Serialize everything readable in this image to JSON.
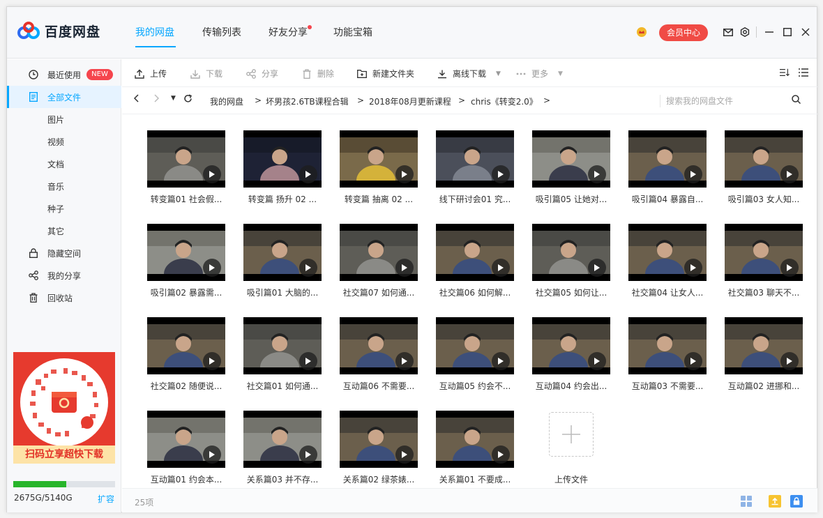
{
  "app": {
    "name": "百度网盘"
  },
  "nav": {
    "tabs": [
      "我的网盘",
      "传输列表",
      "好友分享",
      "功能宝箱"
    ],
    "active_index": 0
  },
  "header": {
    "vip_label": "会员中心"
  },
  "sidebar": {
    "items": [
      {
        "label": "最近使用",
        "badge": "NEW",
        "icon": "clock-icon"
      },
      {
        "label": "全部文件",
        "icon": "file-icon",
        "active": true
      },
      {
        "label": "图片"
      },
      {
        "label": "视频"
      },
      {
        "label": "文档"
      },
      {
        "label": "音乐"
      },
      {
        "label": "种子"
      },
      {
        "label": "其它"
      },
      {
        "label": "隐藏空间",
        "icon": "lock-icon"
      },
      {
        "label": "我的分享",
        "icon": "share-icon"
      },
      {
        "label": "回收站",
        "icon": "trash-icon"
      }
    ],
    "promo_text": "扫码立享超快下载",
    "storage": {
      "text": "2675G/5140G",
      "used_fraction": 0.52,
      "expand_label": "扩容"
    }
  },
  "toolbar": {
    "upload": "上传",
    "download": "下载",
    "share": "分享",
    "delete": "删除",
    "new_folder": "新建文件夹",
    "offline_download": "离线下载",
    "more": "更多"
  },
  "breadcrumb": {
    "items": [
      "我的网盘",
      "坏男孩2.6TB课程合辑",
      "2018年08月更新课程",
      "chris《转变2.0》"
    ],
    "separator": ">"
  },
  "search": {
    "placeholder": "搜索我的网盘文件"
  },
  "files": [
    {
      "name": "转变篇01 社会假...",
      "scene": "a"
    },
    {
      "name": "转变篇 扬升 02 ...",
      "scene": "f"
    },
    {
      "name": "转变篇 抽离 02 ...",
      "scene": "y"
    },
    {
      "name": "线下研讨会01 究...",
      "scene": "c"
    },
    {
      "name": "吸引篇05 让她对...",
      "scene": "o"
    },
    {
      "name": "吸引篇04 暴露自...",
      "scene": "b"
    },
    {
      "name": "吸引篇03 女人知...",
      "scene": "b"
    },
    {
      "name": "吸引篇02 暴露需...",
      "scene": "o"
    },
    {
      "name": "吸引篇01 大脑的...",
      "scene": "b"
    },
    {
      "name": "社交篇07 如何通...",
      "scene": "a"
    },
    {
      "name": "社交篇06 如何解...",
      "scene": "b"
    },
    {
      "name": "社交篇05 如何让...",
      "scene": "a"
    },
    {
      "name": "社交篇04 让女人...",
      "scene": "b"
    },
    {
      "name": "社交篇03 聊天不...",
      "scene": "b"
    },
    {
      "name": "社交篇02 随便说...",
      "scene": "b"
    },
    {
      "name": "社交篇01 如何通...",
      "scene": "a"
    },
    {
      "name": "互动篇06 不需要...",
      "scene": "b"
    },
    {
      "name": "互动篇05 约会不...",
      "scene": "b"
    },
    {
      "name": "互动篇04 约会出...",
      "scene": "b"
    },
    {
      "name": "互动篇03 不需要...",
      "scene": "b"
    },
    {
      "name": "互动篇02 进挪和...",
      "scene": "b"
    },
    {
      "name": "互动篇01 约会本...",
      "scene": "o"
    },
    {
      "name": "关系篇03 并不存...",
      "scene": "o"
    },
    {
      "name": "关系篇02 绿茶婊...",
      "scene": "b"
    },
    {
      "name": "关系篇01 不要成...",
      "scene": "b"
    }
  ],
  "upload_tile": {
    "label": "上传文件"
  },
  "status": {
    "count": "25项"
  },
  "colors": {
    "accent": "#06a7ff",
    "vip": "#f04b45",
    "badge": "#f5454d",
    "storage": "#27b52a"
  }
}
